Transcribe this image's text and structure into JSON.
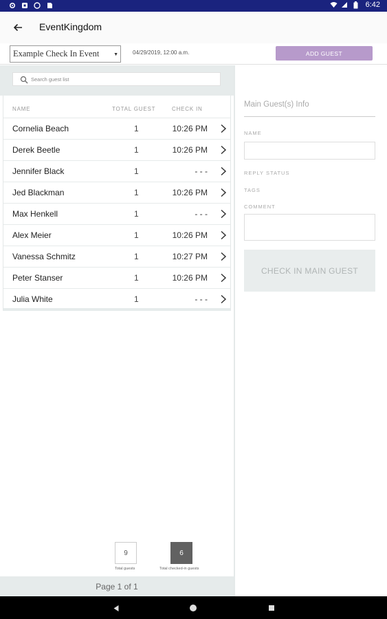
{
  "status_bar": {
    "time": "6:42",
    "left_icons": [
      "gear-icon",
      "shield-icon",
      "circle-icon",
      "sim-card-icon"
    ],
    "right_icons": [
      "wifi-icon",
      "signal-icon",
      "battery-icon"
    ]
  },
  "app_bar": {
    "title": "EventKingdom",
    "back_icon": "arrow-left-icon"
  },
  "event": {
    "selected": "Example Check In Event",
    "date": "04/29/2019, 12:00 a.m.",
    "add_guest_label": "ADD GUEST"
  },
  "search": {
    "placeholder": "Search guest list"
  },
  "table": {
    "headers": {
      "name": "NAME",
      "total": "TOTAL GUEST",
      "checkin": "CHECK IN"
    },
    "rows": [
      {
        "name": "Cornelia Beach",
        "total": "1",
        "checkin": "10:26 PM"
      },
      {
        "name": "Derek Beetle",
        "total": "1",
        "checkin": "10:26 PM"
      },
      {
        "name": "Jennifer Black",
        "total": "1",
        "checkin": "- - -"
      },
      {
        "name": "Jed Blackman",
        "total": "1",
        "checkin": "10:26 PM"
      },
      {
        "name": "Max Henkell",
        "total": "1",
        "checkin": "- - -"
      },
      {
        "name": "Alex Meier",
        "total": "1",
        "checkin": "10:26 PM"
      },
      {
        "name": "Vanessa Schmitz",
        "total": "1",
        "checkin": "10:27 PM"
      },
      {
        "name": "Peter Stanser",
        "total": "1",
        "checkin": "10:26 PM"
      },
      {
        "name": "Julia White",
        "total": "1",
        "checkin": "- - -"
      }
    ]
  },
  "stats": {
    "total_value": "9",
    "total_label": "Total guests",
    "checked_value": "6",
    "checked_label": "Total checked-in guests"
  },
  "pager": {
    "label": "Page 1 of 1"
  },
  "details": {
    "title": "Main Guest(s) Info",
    "name_label": "NAME",
    "reply_label": "REPLY STATUS",
    "tags_label": "TAGS",
    "comment_label": "COMMENT",
    "checkin_button": "CHECK IN MAIN GUEST"
  },
  "nav_bar": {
    "icons": [
      "back-triangle-icon",
      "home-circle-icon",
      "recents-square-icon"
    ]
  },
  "colors": {
    "status_bar": "#1a237e",
    "accent": "#b79acb",
    "panel_bg": "#e6ebeb",
    "checked_box": "#616161"
  }
}
